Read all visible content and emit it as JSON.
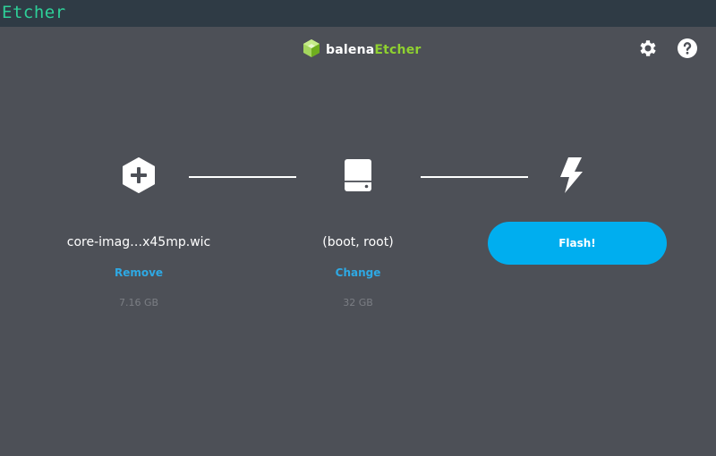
{
  "window": {
    "title": "Etcher"
  },
  "header": {
    "brand_part1": "balena",
    "brand_part2": "Etcher",
    "brand_color": "#8fd130",
    "settings_icon": "gear-icon",
    "help_icon": "question-circle-icon"
  },
  "steps": {
    "image": {
      "icon": "plus-hexagon-icon",
      "name": "core-imag…x45mp.wic",
      "action": "Remove",
      "size": "7.16 GB"
    },
    "drive": {
      "icon": "hard-drive-icon",
      "name": "(boot, root)",
      "action": "Change",
      "size": "32 GB"
    },
    "flash": {
      "icon": "lightning-bolt-icon",
      "button_label": "Flash!"
    }
  },
  "colors": {
    "background": "#4d5057",
    "titlebar": "#2f3b45",
    "title_text": "#2ecf98",
    "accent": "#00aeef",
    "link": "#2ea9e4"
  }
}
